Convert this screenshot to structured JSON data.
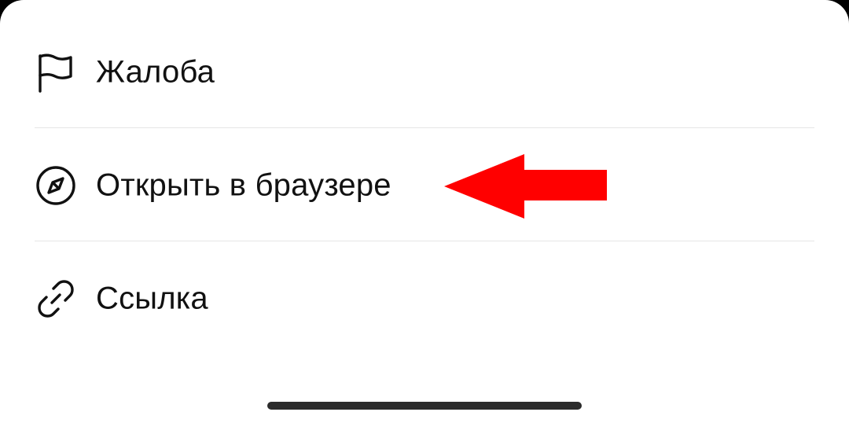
{
  "menu": {
    "items": [
      {
        "label": "Жалоба",
        "icon": "flag-icon"
      },
      {
        "label": "Открыть в браузере",
        "icon": "compass-icon"
      },
      {
        "label": "Ссылка",
        "icon": "link-icon"
      }
    ]
  },
  "annotation": {
    "arrow_color": "#ff0000",
    "points_to": "Открыть в браузере"
  },
  "colors": {
    "background": "#ffffff",
    "text": "#111111",
    "divider": "#e6e6e6",
    "home_indicator": "#2b2b2b"
  }
}
